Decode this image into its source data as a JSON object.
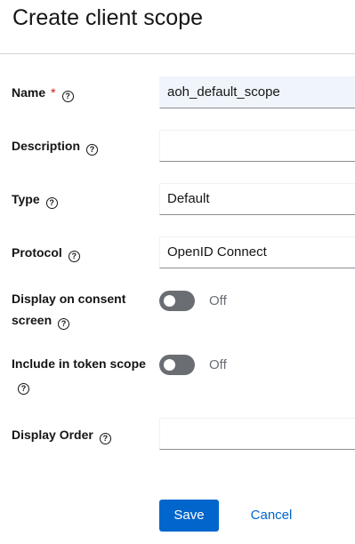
{
  "page_title": "Create client scope",
  "form": {
    "name": {
      "label": "Name",
      "required_marker": "*",
      "value": "aoh_default_scope"
    },
    "description": {
      "label": "Description",
      "value": ""
    },
    "type": {
      "label": "Type",
      "value": "Default"
    },
    "protocol": {
      "label": "Protocol",
      "value": "OpenID Connect"
    },
    "display_on_consent": {
      "label": "Display on consent screen",
      "state_text": "Off"
    },
    "include_in_token": {
      "label": "Include in token scope",
      "state_text": "Off"
    },
    "display_order": {
      "label": "Display Order",
      "value": ""
    }
  },
  "help_glyph": "?",
  "actions": {
    "save": "Save",
    "cancel": "Cancel"
  },
  "colors": {
    "primary": "#0066cc",
    "required": "#c9190b",
    "toggle_off": "#6a6e73",
    "filled_input_bg": "#f0f5fc"
  }
}
